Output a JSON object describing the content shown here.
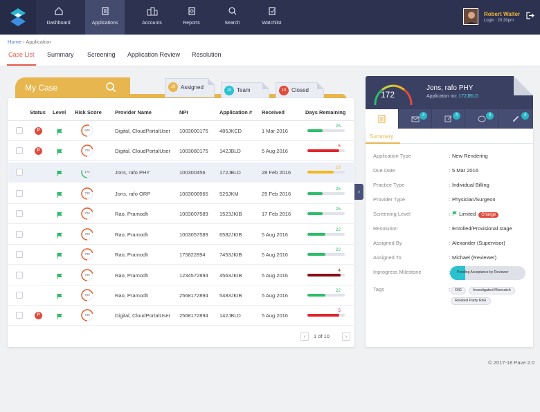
{
  "nav": {
    "items": [
      {
        "label": "Dashboard",
        "icon": "home-icon"
      },
      {
        "label": "Applications",
        "icon": "document-icon"
      },
      {
        "label": "Accounts",
        "icon": "buildings-icon"
      },
      {
        "label": "Reports",
        "icon": "report-icon"
      },
      {
        "label": "Search",
        "icon": "search-icon"
      },
      {
        "label": "Watchlist",
        "icon": "watchlist-icon"
      }
    ],
    "user_name": "Robert Walter",
    "login_time": "Login : 20:30pm"
  },
  "breadcrumb": {
    "home": "Home",
    "sep": "›",
    "current": "Application"
  },
  "tabs": [
    "Case List",
    "Summary",
    "Screening",
    "Application Review",
    "Resolution"
  ],
  "mycase": {
    "title": "My Case"
  },
  "cards": [
    {
      "count": "10",
      "label": "Assigned",
      "color": "#e8b64e"
    },
    {
      "count": "10",
      "label": "Team",
      "color": "#2bc2d0"
    },
    {
      "count": "10",
      "label": "Closed",
      "color": "#e04b3c"
    }
  ],
  "table": {
    "headers": [
      "Status",
      "Level",
      "Risk Score",
      "Provider Name",
      "NPI",
      "Application #",
      "Received",
      "Days Remaining"
    ],
    "rows": [
      {
        "status": "P",
        "risk": "600",
        "provider": "Digital, CloudPortalUser",
        "npi": "1003000175",
        "app": "485JKCD",
        "received": "1 Mar 2016",
        "days": "25",
        "fill": 0.4,
        "color": "#2ebd6a"
      },
      {
        "status": "P",
        "risk": "700",
        "provider": "Digital, CloudPortalUser",
        "npi": "1003080175",
        "app": "142JBLD",
        "received": "5 Aug 2016",
        "days": "5",
        "fill": 0.85,
        "color": "#e0252e"
      },
      {
        "status": "",
        "risk": "172",
        "provider": "Jons, rafo PHY",
        "npi": "100300456",
        "app": "172JBLD",
        "received": "28 Feb 2016",
        "days": "16",
        "fill": 0.7,
        "color": "#f2b81e"
      },
      {
        "status": "",
        "risk": "700",
        "provider": "Jons, rafo ORP",
        "npi": "1003008965",
        "app": "525JKM",
        "received": "29 Feb 2016",
        "days": "25",
        "fill": 0.4,
        "color": "#2ebd6a"
      },
      {
        "status": "",
        "risk": "700",
        "provider": "Rao, Pramodh",
        "npi": "1003007589",
        "app": "1523JKIB",
        "received": "17 Feb 2016",
        "days": "25",
        "fill": 0.4,
        "color": "#2ebd6a"
      },
      {
        "status": "",
        "risk": "700",
        "provider": "Rao, Pramodh",
        "npi": "1003057589",
        "app": "6582JKIB",
        "received": "5 Aug 2016",
        "days": "22",
        "fill": 0.48,
        "color": "#2ebd6a"
      },
      {
        "status": "",
        "risk": "700",
        "provider": "Rao, Pramodh",
        "npi": "175822894",
        "app": "7453JKIB",
        "received": "5 Aug 2016",
        "days": "22",
        "fill": 0.48,
        "color": "#2ebd6a"
      },
      {
        "status": "",
        "risk": "700",
        "provider": "Rao, Pramodh",
        "npi": "1234572894",
        "app": "4563JKIB",
        "received": "5 Aug 2016",
        "days": "4",
        "fill": 0.88,
        "color": "#8b0e14"
      },
      {
        "status": "",
        "risk": "700",
        "provider": "Rao, Pramodh",
        "npi": "2568172894",
        "app": "5483JKIB",
        "received": "5 Aug 2016",
        "days": "22",
        "fill": 0.48,
        "color": "#2ebd6a"
      },
      {
        "status": "P",
        "risk": "700",
        "provider": "Digital, CloudPortalUser",
        "npi": "2568172894",
        "app": "142JBLD",
        "received": "5 Aug 2016",
        "days": "5",
        "fill": 0.85,
        "color": "#e0252e"
      }
    ]
  },
  "pager": {
    "prev": "‹",
    "text": "1 of 10",
    "next": "›"
  },
  "detail": {
    "name": "Jons, rafo PHY",
    "app_label": "Applicaton no:",
    "app_no": "172JBLD",
    "score": "172",
    "tab_counts": [
      "4",
      "4",
      "4",
      "4"
    ],
    "summary_tab": "Summary",
    "fields": [
      {
        "label": "Application Type",
        "value": "New Rendering"
      },
      {
        "label": "Due Date",
        "value": "5 Mar 2016"
      },
      {
        "label": "Practice Type",
        "value": "Individual Billing"
      },
      {
        "label": "Provider Type",
        "value": "Physician/Surgeon"
      },
      {
        "label": "Screening Level",
        "value": "Limited"
      },
      {
        "label": "Resolution",
        "value": "Enrolled/Provisional stage"
      },
      {
        "label": "Assigned By",
        "value": "Alexander (Supervisor)"
      },
      {
        "label": "Assigned To",
        "value": "Michael (Reviewer)"
      },
      {
        "label": "Inprogress Milestone",
        "value": ""
      },
      {
        "label": "Tags",
        "value": ""
      }
    ],
    "change_label": "Change",
    "milestone": "Pending Acceptance by Reviewer",
    "milestone_progress": 0.2,
    "tags": [
      "OIG",
      "Investigated Mismatch",
      "Related Party Risk"
    ]
  },
  "footer": "© 2017-18  Pave 2.0"
}
